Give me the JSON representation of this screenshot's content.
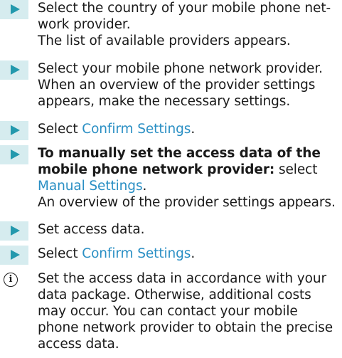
{
  "steps": [
    {
      "lines": [
        "Select the country of your mobile phone net-",
        "work provider.",
        "The list of available providers appears."
      ]
    },
    {
      "lines": [
        "Select your mobile phone network provider.",
        "When an overview of the provider settings",
        "appears, make the necessary settings."
      ]
    },
    {
      "prefix": "Select ",
      "link": "Confirm Settings",
      "suffix": "."
    },
    {
      "bold_line1": "To manually set the access data of the",
      "bold_line2": "mobile phone network provider:",
      "after_bold": " select",
      "link": "Manual Settings",
      "suffix": ".",
      "result": "An overview of the provider settings appears."
    },
    {
      "lines": [
        "Set access data."
      ]
    },
    {
      "prefix": "Select ",
      "link": "Confirm Settings",
      "suffix": "."
    }
  ],
  "note": {
    "icon": "info-icon",
    "icon_glyph": "i",
    "lines": [
      "Set the access data in accordance with your",
      "data package. Otherwise, additional costs",
      "may occur. You can contact your mobile",
      "phone network provider to obtain the precise",
      "access data."
    ]
  },
  "colors": {
    "marker_bg": "#d6ecef",
    "arrow": "#2399ad",
    "link": "#2a8fc4",
    "text": "#1a1a1a"
  }
}
